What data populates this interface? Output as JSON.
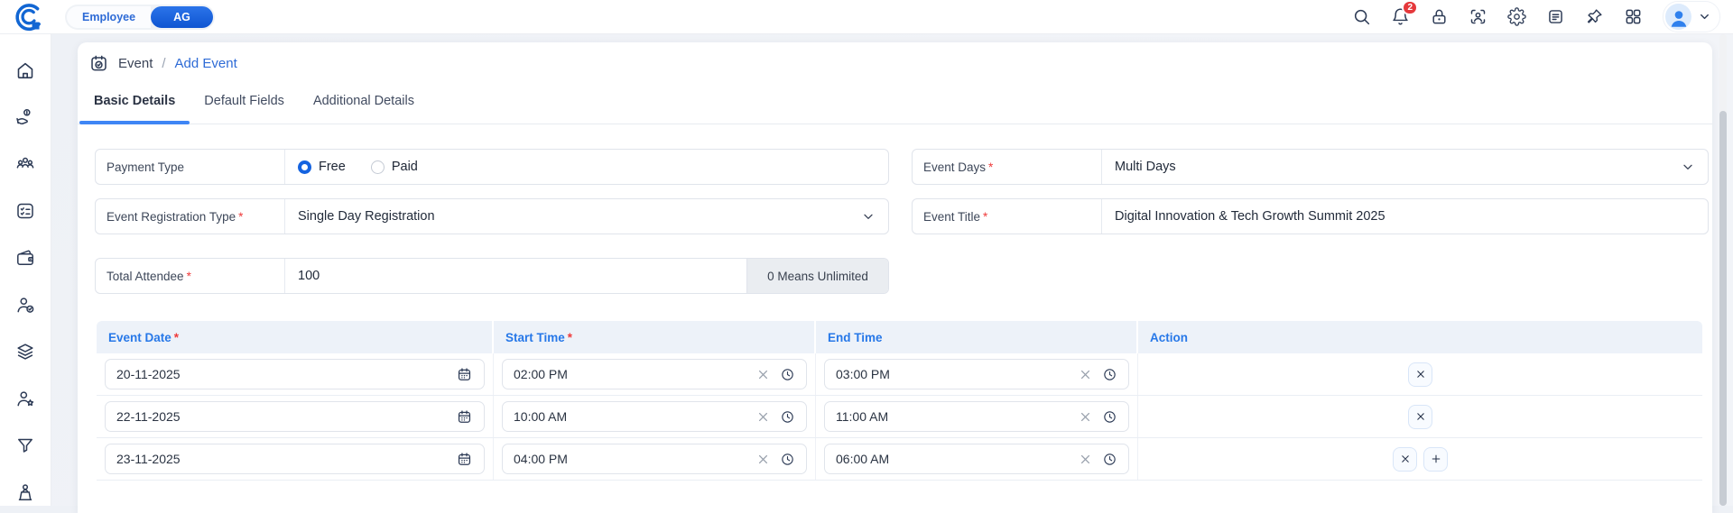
{
  "topbar": {
    "role_toggle": {
      "options": [
        {
          "label": "Employee",
          "selected": false
        },
        {
          "label": "AG",
          "selected": true
        }
      ]
    },
    "notifications_badge": "2",
    "icons": [
      "search",
      "notification-bell",
      "lock",
      "face-id-scan",
      "settings-gear",
      "notes",
      "pin",
      "apps-grid",
      "user-avatar",
      "chevron-down"
    ]
  },
  "sidebar": {
    "icons": [
      "home",
      "payroll-hand-coin",
      "meeting-room",
      "task-checklist",
      "wallet",
      "employee-check",
      "layers-stack",
      "employee-star",
      "filter-funnel",
      "speaker-podium"
    ]
  },
  "breadcrumb": {
    "section": "Event",
    "separator": "/",
    "current": "Add Event"
  },
  "tabs": [
    {
      "label": "Basic Details",
      "active": true
    },
    {
      "label": "Default Fields",
      "active": false
    },
    {
      "label": "Additional Details",
      "active": false
    }
  ],
  "form": {
    "payment_type": {
      "label": "Payment Type",
      "options": [
        {
          "label": "Free",
          "selected": true
        },
        {
          "label": "Paid",
          "selected": false
        }
      ]
    },
    "event_days": {
      "label": "Event Days",
      "required_mark": "*",
      "value": "Multi Days"
    },
    "event_registration_type": {
      "label": "Event Registration Type",
      "required_mark": "*",
      "value": "Single Day Registration"
    },
    "event_title": {
      "label": "Event Title",
      "required_mark": "*",
      "value": "Digital Innovation & Tech Growth Summit 2025"
    },
    "total_attendee": {
      "label": "Total Attendee",
      "required_mark": "*",
      "value": "100",
      "suffix": "0 Means Unlimited"
    }
  },
  "schedule_table": {
    "columns": [
      {
        "label": "Event Date",
        "required_mark": "*"
      },
      {
        "label": "Start Time",
        "required_mark": "*"
      },
      {
        "label": "End Time",
        "required_mark": ""
      },
      {
        "label": "Action",
        "required_mark": ""
      }
    ],
    "rows": [
      {
        "event_date": "20-11-2025",
        "start_time": "02:00 PM",
        "end_time": "03:00 PM"
      },
      {
        "event_date": "22-11-2025",
        "start_time": "10:00 AM",
        "end_time": "11:00 AM"
      },
      {
        "event_date": "23-11-2025",
        "start_time": "04:00 PM",
        "end_time": "06:00 AM"
      }
    ]
  },
  "colors": {
    "accent_blue": "#1563e0",
    "link_blue": "#2e6bd6",
    "table_header_blue": "#2778e8",
    "badge_red": "#e5383b",
    "icon_navy": "#2c3a55"
  }
}
